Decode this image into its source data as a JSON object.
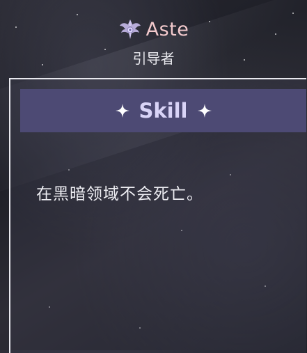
{
  "character": {
    "name": "Aste",
    "title": "引导者",
    "emblem_icon": "winged-crest-icon"
  },
  "skill_panel": {
    "heading": "Skill",
    "sparkle_icon": "four-point-star-icon",
    "description": "在黑暗领域不会死亡。"
  },
  "colors": {
    "name": "#f2c9cc",
    "header_bg": "#4d4a74",
    "heading_text": "#d9d4f7",
    "panel_border": "#e8e8ee"
  }
}
